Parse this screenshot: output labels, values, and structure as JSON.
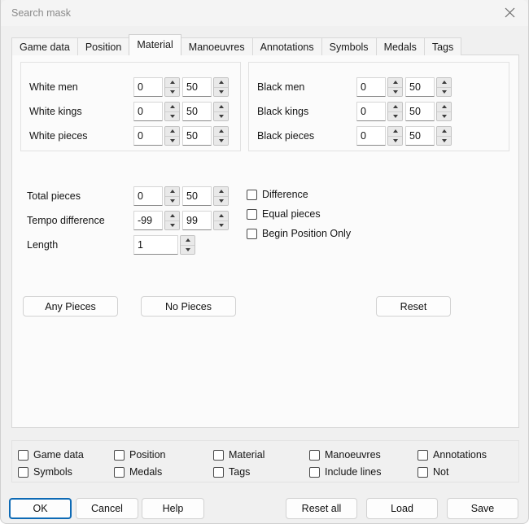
{
  "window": {
    "title": "Search mask",
    "close_icon": "close-icon"
  },
  "tabs": [
    {
      "label": "Game data",
      "active": false
    },
    {
      "label": "Position",
      "active": false
    },
    {
      "label": "Material",
      "active": true
    },
    {
      "label": "Manoeuvres",
      "active": false
    },
    {
      "label": "Annotations",
      "active": false
    },
    {
      "label": "Symbols",
      "active": false
    },
    {
      "label": "Medals",
      "active": false
    },
    {
      "label": "Tags",
      "active": false
    }
  ],
  "material": {
    "white_group": [
      {
        "label": "White men",
        "min": "0",
        "max": "50"
      },
      {
        "label": "White kings",
        "min": "0",
        "max": "50"
      },
      {
        "label": "White pieces",
        "min": "0",
        "max": "50"
      }
    ],
    "black_group": [
      {
        "label": "Black men",
        "min": "0",
        "max": "50"
      },
      {
        "label": "Black kings",
        "min": "0",
        "max": "50"
      },
      {
        "label": "Black pieces",
        "min": "0",
        "max": "50"
      }
    ],
    "totals": [
      {
        "label": "Total pieces",
        "min": "0",
        "max": "50"
      },
      {
        "label": "Tempo difference",
        "min": "-99",
        "max": "99"
      }
    ],
    "length": {
      "label": "Length",
      "value": "1"
    },
    "option_checks": [
      {
        "label": "Difference",
        "checked": false
      },
      {
        "label": "Equal pieces",
        "checked": false
      },
      {
        "label": "Begin Position Only",
        "checked": false
      }
    ],
    "buttons": {
      "any_pieces": "Any Pieces",
      "no_pieces": "No Pieces",
      "reset": "Reset"
    }
  },
  "scope_checks": [
    {
      "label": "Game data",
      "checked": false
    },
    {
      "label": "Position",
      "checked": false
    },
    {
      "label": "Material",
      "checked": false
    },
    {
      "label": "Manoeuvres",
      "checked": false
    },
    {
      "label": "Annotations",
      "checked": false
    },
    {
      "label": "Symbols",
      "checked": false
    },
    {
      "label": "Medals",
      "checked": false
    },
    {
      "label": "Tags",
      "checked": false
    },
    {
      "label": "Include lines",
      "checked": false
    },
    {
      "label": "Not",
      "checked": false
    }
  ],
  "dialog_buttons": {
    "ok": "OK",
    "cancel": "Cancel",
    "help": "Help",
    "reset_all": "Reset all",
    "load": "Load",
    "save": "Save"
  },
  "colors": {
    "accent": "#0d6ab5",
    "window_bg": "#f0f0f0",
    "pane_bg": "#fbfbfb",
    "title_text": "#8a8a8a"
  }
}
